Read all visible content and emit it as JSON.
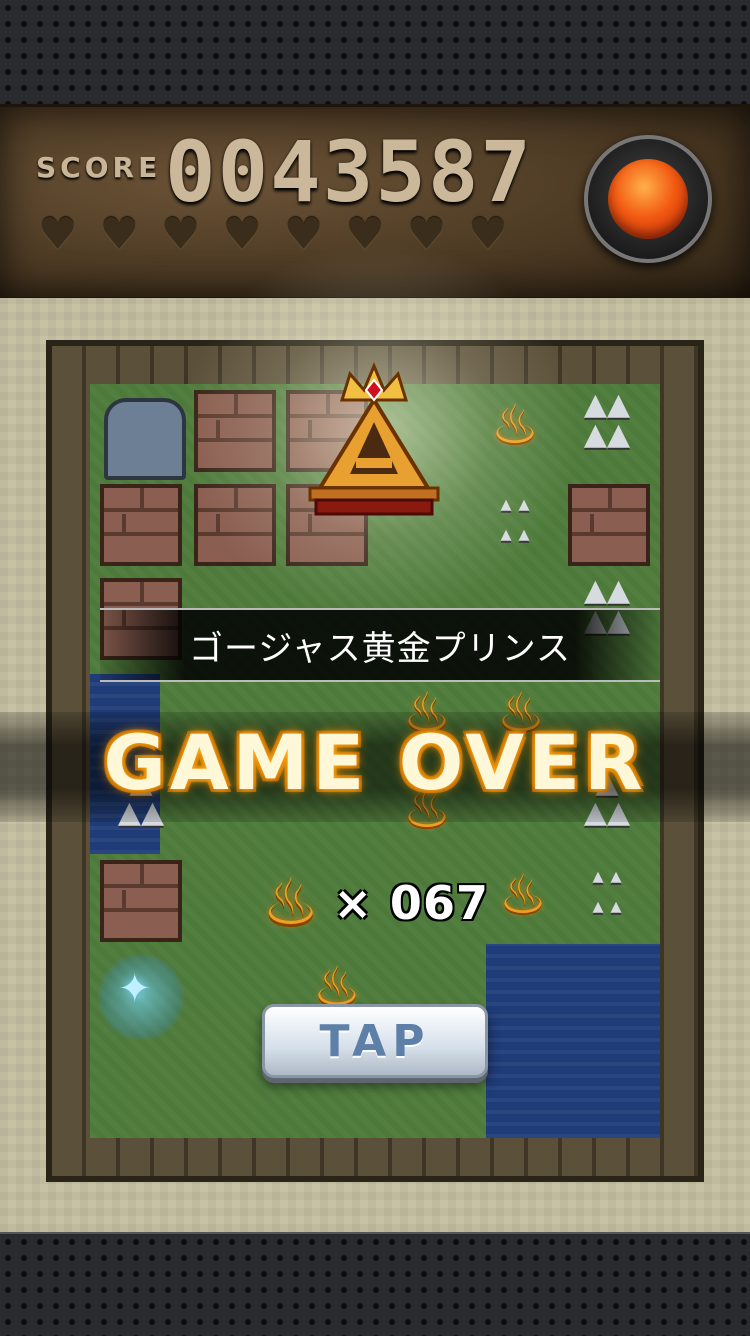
{
  "hud": {
    "score_label": "SCORE",
    "score_value": "0043587",
    "hearts": [
      "♥",
      "♥",
      "♥",
      "♥",
      "♥",
      "♥",
      "♥",
      "♥"
    ],
    "record_button_icon": "record-icon"
  },
  "result": {
    "title": "ゴージャス黄金プリンス",
    "game_over": "GAME OVER",
    "count_icon": "flame-icon",
    "count_text": "× 067",
    "tap_label": "TAP"
  },
  "colors": {
    "score_text": "#cbb89a",
    "game_over_glow": "#ff9a00",
    "record_core": "#f25a12",
    "tap_text": "#5e7fa8"
  }
}
